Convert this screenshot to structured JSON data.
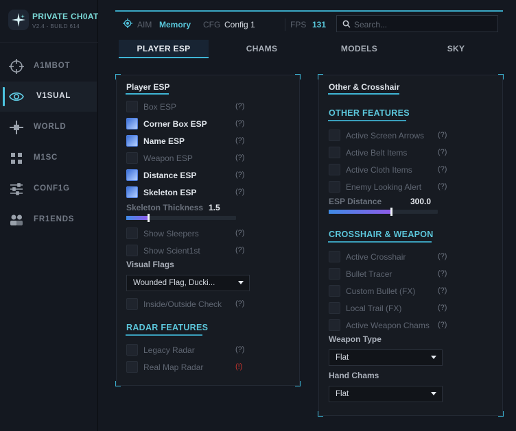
{
  "brand": {
    "title": "PRIVATE CH0AT",
    "subtitle": "V2.4 - BUILD 614"
  },
  "sidebar": {
    "items": [
      {
        "label": "A1MBOT",
        "icon": "crosshair-icon"
      },
      {
        "label": "V1SUAL",
        "icon": "eye-icon"
      },
      {
        "label": "WORLD",
        "icon": "world-icon"
      },
      {
        "label": "M1SC",
        "icon": "grid-icon"
      },
      {
        "label": "CONF1G",
        "icon": "sliders-icon"
      },
      {
        "label": "FR1ENDS",
        "icon": "friends-icon"
      }
    ]
  },
  "topbar": {
    "aim_label": "AIM",
    "aim_value": "Memory",
    "cfg_label": "CFG",
    "cfg_value": "Config 1",
    "fps_label": "FPS",
    "fps_value": "131",
    "search_placeholder": "Search..."
  },
  "tabs": [
    "PLAYER ESP",
    "CHAMS",
    "MODELS",
    "SKY"
  ],
  "left": {
    "title": "Player ESP",
    "items": [
      {
        "label": "Box ESP",
        "help": "(?)",
        "checked": false
      },
      {
        "label": "Corner Box ESP",
        "help": "(?)",
        "checked": true
      },
      {
        "label": "Name ESP",
        "help": "(?)",
        "checked": true
      },
      {
        "label": "Weapon ESP",
        "help": "(?)",
        "checked": false
      },
      {
        "label": "Distance ESP",
        "help": "(?)",
        "checked": true
      },
      {
        "label": "Skeleton ESP",
        "help": "(?)",
        "checked": true
      }
    ],
    "thickness_label": "Skeleton Thickness",
    "thickness_value": "1.5",
    "thickness_fraction": 0.2,
    "items2": [
      {
        "label": "Show Sleepers",
        "help": "(?)",
        "checked": false
      },
      {
        "label": "Show Scient1st",
        "help": "(?)",
        "checked": false
      }
    ],
    "flags_label": "Visual Flags",
    "flags_value": "Wounded Flag, Ducki...",
    "inside_check": {
      "label": "Inside/Outside Check",
      "help": "(?)",
      "checked": false
    },
    "radar_title": "RADAR FEATURES",
    "radar_items": [
      {
        "label": "Legacy Radar",
        "help": "(?)",
        "checked": false
      },
      {
        "label": "Real Map Radar",
        "help": "(!)",
        "checked": false
      }
    ]
  },
  "right": {
    "title": "Other & Crosshair",
    "other_title": "OTHER FEATURES",
    "other_items": [
      {
        "label": "Active Screen Arrows",
        "help": "(?)",
        "checked": false
      },
      {
        "label": "Active Belt Items",
        "help": "(?)",
        "checked": false
      },
      {
        "label": "Active Cloth Items",
        "help": "(?)",
        "checked": false
      },
      {
        "label": "Enemy Looking Alert",
        "help": "(?)",
        "checked": false
      }
    ],
    "distance_label": "ESP Distance",
    "distance_value": "300.0",
    "distance_fraction": 0.57,
    "crosshair_title": "CROSSHAIR & WEAPON",
    "crosshair_items": [
      {
        "label": "Active Crosshair",
        "help": "(?)",
        "checked": false
      },
      {
        "label": "Bullet Tracer",
        "help": "(?)",
        "checked": false
      },
      {
        "label": "Custom Bullet (FX)",
        "help": "(?)",
        "checked": false
      },
      {
        "label": "Local Trail (FX)",
        "help": "(?)",
        "checked": false
      },
      {
        "label": "Active Weapon Chams",
        "help": "(?)",
        "checked": false
      }
    ],
    "weapon_type_label": "Weapon Type",
    "weapon_type_value": "Flat",
    "hand_chams_label": "Hand Chams",
    "hand_chams_value": "Flat"
  },
  "colors": {
    "accent": "#3fb6d6",
    "check_on": "#3a6fd8",
    "warn": "#c8342e"
  }
}
